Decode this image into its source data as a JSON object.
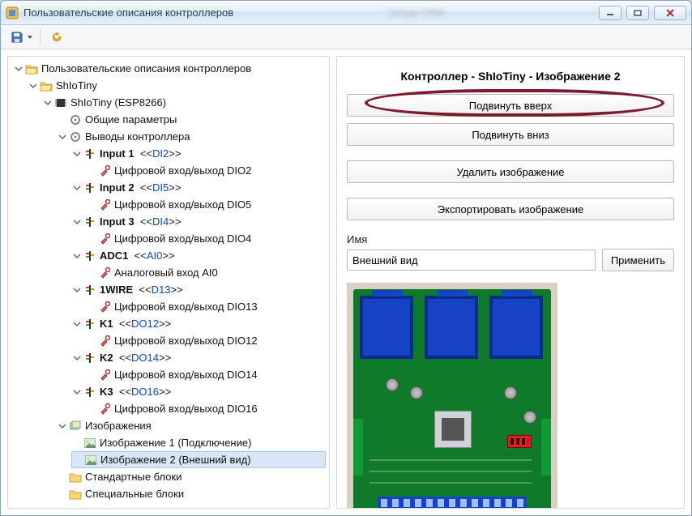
{
  "window": {
    "title": "Пользовательские описания контроллеров",
    "blurred_center": "Simply CRM"
  },
  "toolbar": {
    "save_tip": "Сохранить",
    "refresh_tip": "Обновить"
  },
  "tree": {
    "root": "Пользовательские описания контроллеров",
    "shiotiny": "ShIoTiny",
    "shiotiny_esp": "ShIoTiny (ESP8266)",
    "common_params": "Общие параметры",
    "outputs": "Выводы контроллера",
    "input1": {
      "name": "Input 1",
      "code": "DI2",
      "sub": "Цифровой вход/выход DIO2"
    },
    "input2": {
      "name": "Input 2",
      "code": "DI5",
      "sub": "Цифровой вход/выход DIO5"
    },
    "input3": {
      "name": "Input 3",
      "code": "DI4",
      "sub": "Цифровой вход/выход DIO4"
    },
    "adc1": {
      "name": "ADC1",
      "code": "AI0",
      "sub": "Аналоговый вход AI0"
    },
    "onewire": {
      "name": "1WIRE",
      "code": "D13",
      "sub": "Цифровой вход/выход DIO13"
    },
    "k1": {
      "name": "K1",
      "code": "DO12",
      "sub": "Цифровой вход/выход DIO12"
    },
    "k2": {
      "name": "K2",
      "code": "DO14",
      "sub": "Цифровой вход/выход DIO14"
    },
    "k3": {
      "name": "K3",
      "code": "DO16",
      "sub": "Цифровой вход/выход DIO16"
    },
    "images": "Изображения",
    "image1": "Изображение 1 (Подключение)",
    "image2": "Изображение 2 (Внешний вид)",
    "std_blocks": "Стандартные блоки",
    "spec_blocks": "Специальные блоки"
  },
  "right": {
    "title": "Контроллер - ShIoTiny - Изображение 2",
    "btn_up": "Подвинуть вверх",
    "btn_down": "Подвинуть вниз",
    "btn_delete": "Удалить изображение",
    "btn_export": "Экспортировать изображение",
    "name_label": "Имя",
    "name_value": "Внешний вид",
    "apply": "Применить"
  },
  "brackets": {
    "open": "<<",
    "close": ">>"
  }
}
